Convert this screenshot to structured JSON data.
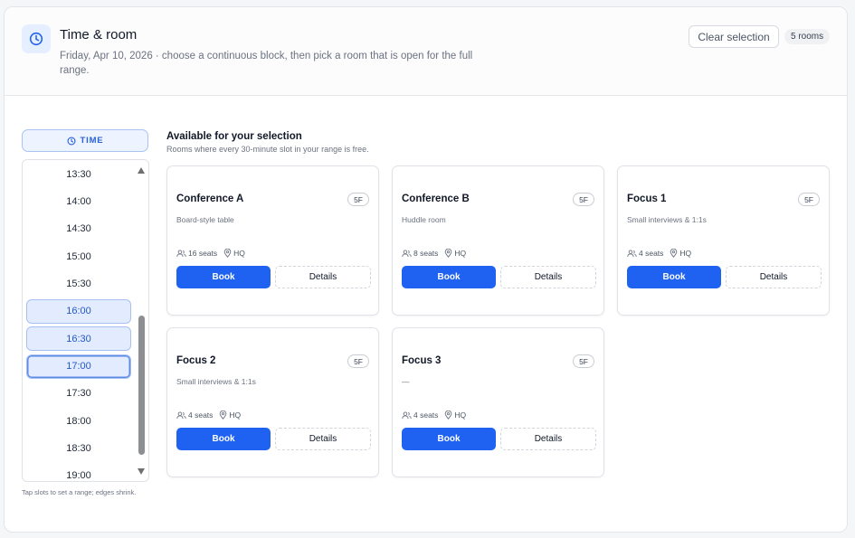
{
  "header": {
    "title": "Time & room",
    "subtitle": "Friday, Apr 10, 2026 · choose a continuous block, then pick a room that is open for the full range.",
    "clear_label": "Clear selection",
    "rooms_count": "5 rooms",
    "icon": "clock-icon"
  },
  "time_panel": {
    "chip_label": "TIME",
    "slots": [
      {
        "label": "13:30",
        "selected": false
      },
      {
        "label": "14:00",
        "selected": false
      },
      {
        "label": "14:30",
        "selected": false
      },
      {
        "label": "15:00",
        "selected": false
      },
      {
        "label": "15:30",
        "selected": false
      },
      {
        "label": "16:00",
        "selected": true
      },
      {
        "label": "16:30",
        "selected": true
      },
      {
        "label": "17:00",
        "selected": true
      },
      {
        "label": "17:30",
        "selected": false
      },
      {
        "label": "18:00",
        "selected": false
      },
      {
        "label": "18:30",
        "selected": false
      },
      {
        "label": "19:00",
        "selected": false
      }
    ],
    "hint": "Tap slots to set a range; edges shrink."
  },
  "results": {
    "title": "Available for your selection",
    "subtitle": "Rooms where every 30-minute slot in your range is free.",
    "book_label": "Book",
    "details_label": "Details",
    "rooms": [
      {
        "name": "Conference A",
        "floor": "5F",
        "desc": "Board-style table",
        "seats": "16 seats",
        "site": "HQ"
      },
      {
        "name": "Conference B",
        "floor": "5F",
        "desc": "Huddle room",
        "seats": "8 seats",
        "site": "HQ"
      },
      {
        "name": "Focus 1",
        "floor": "5F",
        "desc": "Small interviews & 1:1s",
        "seats": "4 seats",
        "site": "HQ"
      },
      {
        "name": "Focus 2",
        "floor": "5F",
        "desc": "Small interviews & 1:1s",
        "seats": "4 seats",
        "site": "HQ"
      },
      {
        "name": "Focus 3",
        "floor": "5F",
        "desc": "—",
        "seats": "4 seats",
        "site": "HQ"
      }
    ]
  },
  "colors": {
    "accent": "#1f62f2",
    "selected_bg": "#e3ecff",
    "selected_text": "#2458c9"
  }
}
